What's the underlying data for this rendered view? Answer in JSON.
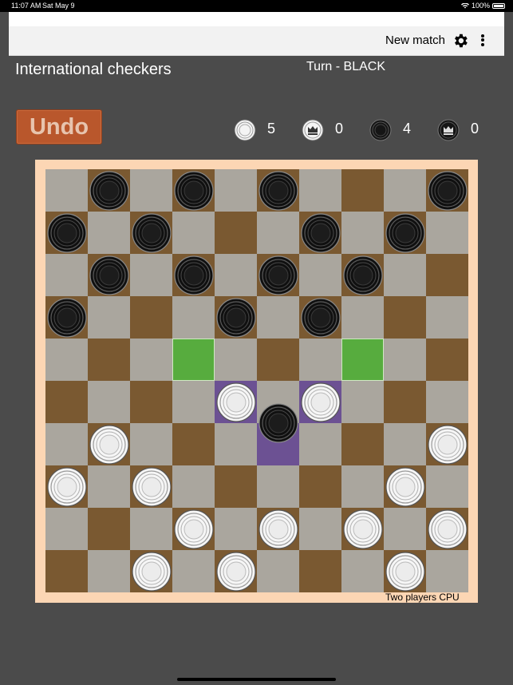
{
  "status_bar": {
    "time": "11:07 AM",
    "date": "Sat May 9",
    "battery": "100%"
  },
  "toolbar": {
    "new_match_label": "New match"
  },
  "header": {
    "title": "International checkers",
    "turn": "Turn - BLACK"
  },
  "controls": {
    "undo_label": "Undo"
  },
  "scores": {
    "white_men": "5",
    "white_kings": "0",
    "black_men": "4",
    "black_kings": "0"
  },
  "board": {
    "size": 10,
    "colors": {
      "light": "#aaa69e",
      "dark": "#7a5931",
      "highlight_move": "#57ac3e",
      "highlight_path": "#6c5193",
      "frame": "#fcd6b4"
    },
    "highlights": [
      {
        "row": 4,
        "col": 3,
        "kind": "move"
      },
      {
        "row": 4,
        "col": 7,
        "kind": "move"
      },
      {
        "row": 5,
        "col": 4,
        "kind": "path"
      },
      {
        "row": 5,
        "col": 6,
        "kind": "path"
      },
      {
        "row": 6,
        "col": 5,
        "kind": "path"
      }
    ],
    "black_pieces": [
      [
        0,
        1
      ],
      [
        0,
        3
      ],
      [
        0,
        5
      ],
      [
        0,
        9
      ],
      [
        1,
        0
      ],
      [
        1,
        2
      ],
      [
        1,
        6
      ],
      [
        1,
        8
      ],
      [
        2,
        1
      ],
      [
        2,
        3
      ],
      [
        2,
        5
      ],
      [
        2,
        7
      ],
      [
        3,
        0
      ],
      [
        3,
        4
      ],
      [
        3,
        6
      ]
    ],
    "white_pieces": [
      [
        5,
        4
      ],
      [
        5,
        6
      ],
      [
        6,
        1
      ],
      [
        6,
        9
      ],
      [
        7,
        0
      ],
      [
        7,
        2
      ],
      [
        7,
        8
      ],
      [
        8,
        3
      ],
      [
        8,
        5
      ],
      [
        8,
        7
      ],
      [
        8,
        9
      ],
      [
        9,
        2
      ],
      [
        9,
        4
      ],
      [
        9,
        8
      ]
    ],
    "floating_piece": {
      "color": "black",
      "row": 5.5,
      "col": 5
    }
  },
  "footer": {
    "mode_label": "Two players CPU"
  }
}
